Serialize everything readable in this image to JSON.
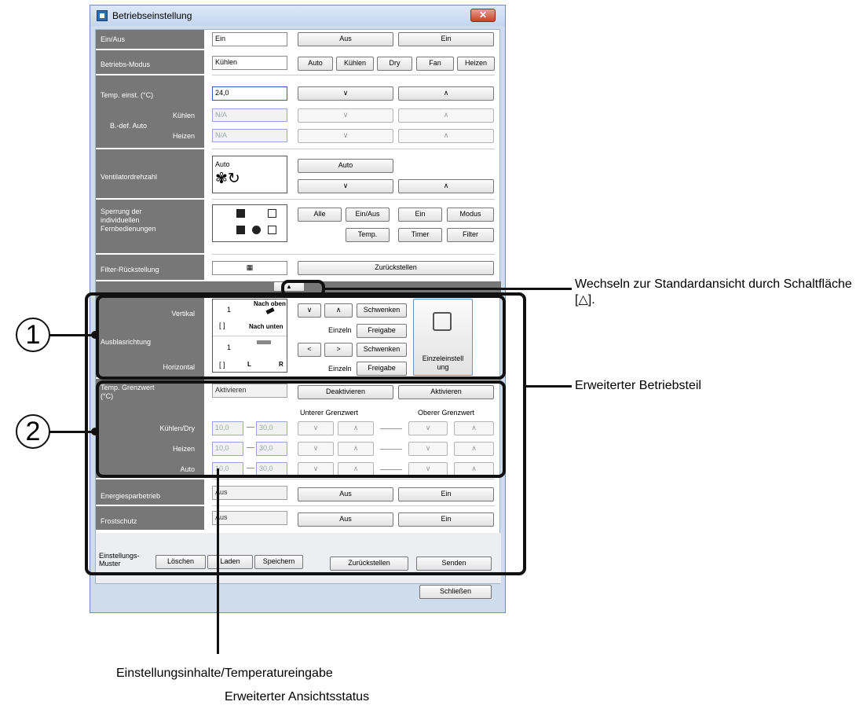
{
  "window": {
    "title": "Betriebseinstellung",
    "close_label": "✕"
  },
  "rows": {
    "power": {
      "label": "Ein/Aus",
      "value": "Ein",
      "btn_off": "Aus",
      "btn_on": "Ein"
    },
    "mode": {
      "label": "Betriebs-Modus",
      "value": "Kühlen",
      "buttons": [
        "Auto",
        "Kühlen",
        "Dry",
        "Fan",
        "Heizen"
      ]
    },
    "temp": {
      "label": "Temp. einst. (°C)",
      "value": "24,0",
      "down": "∨",
      "up": "∧"
    },
    "bdef": {
      "label": "B.-def. Auto",
      "cool_label": "Kühlen",
      "heat_label": "Heizen",
      "cool_value": "N/A",
      "heat_value": "N/A"
    },
    "fan": {
      "label": "Ventilatordrehzahl",
      "value": "Auto",
      "auto_btn": "Auto"
    },
    "lock": {
      "label_lines": [
        "Sperrung der",
        "individuellen",
        "Fernbedienungen"
      ],
      "buttons_row1": [
        "Alle",
        "Ein/Aus",
        "Ein",
        "Modus"
      ],
      "buttons_row2": [
        "Temp.",
        "Timer",
        "Filter"
      ]
    },
    "filter": {
      "label": "Filter-Rückstellung",
      "reset_btn": "Zurückstellen"
    },
    "louver": {
      "label": "Ausblasrichtung",
      "vertical_label": "Vertikal",
      "horizontal_label": "Horizontal",
      "v_value": "1",
      "v_bracket": "[    ]",
      "nach_oben": "Nach oben",
      "nach_unten": "Nach unten",
      "h_value": "1",
      "h_bracket": "[    ]",
      "l": "L",
      "r": "R",
      "btn_swing": "Schwenken",
      "btn_release": "Freigabe",
      "einzeln": "Einzeln",
      "individual_btn": "Einzeleinstell ung",
      "left": "<",
      "right": ">"
    },
    "limit": {
      "label_lines": [
        "Temp. Grenzwert",
        "(°C)"
      ],
      "value": "Aktivieren",
      "btn_deact": "Deaktivieren",
      "btn_act": "Aktivieren",
      "lower_label": "Unterer Grenzwert",
      "upper_label": "Oberer Grenzwert",
      "cool_dry": "Kühlen/Dry",
      "heat": "Heizen",
      "auto": "Auto",
      "low_val": "10,0",
      "high_val": "30,0",
      "dash": "—"
    },
    "energy": {
      "label": "Energiesparbetrieb",
      "value": "Aus",
      "btn_off": "Aus",
      "btn_on": "Ein"
    },
    "frost": {
      "label": "Frostschutz",
      "value": "Aus",
      "btn_off": "Aus",
      "btn_on": "Ein"
    }
  },
  "bottom": {
    "pattern_label": "Einstellungs- Muster",
    "delete": "Löschen",
    "load": "Laden",
    "save": "Speichern",
    "reset": "Zurückstellen",
    "send": "Senden",
    "close": "Schließen",
    "collapse": "▲"
  },
  "annotations": {
    "standard_view": "Wechseln zur Standardansicht durch Schaltfläche [△].",
    "extended_section": "Erweiterter Betriebsteil",
    "settings_input": "Einstellungsinhalte/Temperatureingabe",
    "extended_status": "Erweiterter Ansichtsstatus",
    "circle1": "1",
    "circle2": "2"
  }
}
